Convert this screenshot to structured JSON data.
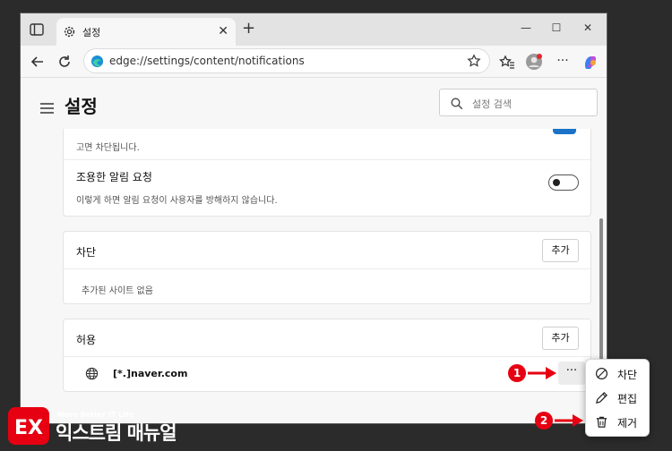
{
  "tab": {
    "title": "설정"
  },
  "address": {
    "url": "edge://settings/content/notifications"
  },
  "header": {
    "title": "설정",
    "search_placeholder": "설정 검색"
  },
  "notifications": {
    "top_desc": "고면 차단됩니다.",
    "quiet_title": "조용한 알림 요청",
    "quiet_desc": "이렇게 하면 알림 요청이 사용자를 방해하지 않습니다.",
    "quiet_enabled": false
  },
  "block": {
    "title": "차단",
    "add_label": "추가",
    "empty_message": "추가된 사이트 없음"
  },
  "allow": {
    "title": "허용",
    "add_label": "추가",
    "sites": [
      {
        "name": "[*.]naver.com"
      }
    ]
  },
  "context_menu": {
    "items": [
      {
        "label": "차단",
        "icon": "block-icon"
      },
      {
        "label": "편집",
        "icon": "pencil-icon"
      },
      {
        "label": "제거",
        "icon": "trash-icon"
      }
    ]
  },
  "annotations": {
    "step1": "1",
    "step2": "2"
  },
  "watermark": {
    "tagline": "More Better IT Life",
    "name": "익스트림 매뉴얼",
    "logo_letters": "EX"
  },
  "colors": {
    "accent": "#1a73c8",
    "annotation": "#e60012"
  }
}
